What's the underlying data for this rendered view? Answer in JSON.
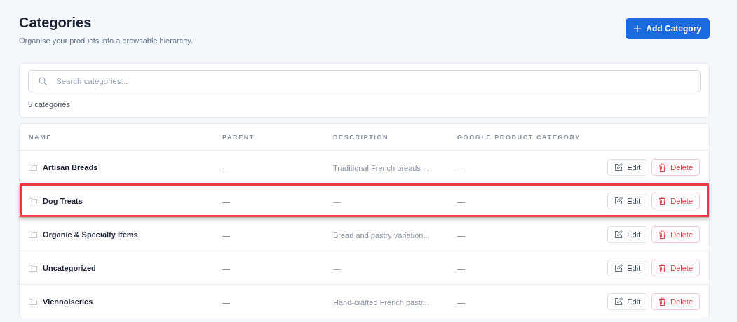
{
  "header": {
    "title": "Categories",
    "subtitle": "Organise your products into a browsable hierarchy.",
    "add_button": "Add Category"
  },
  "search": {
    "placeholder": "Search categories...",
    "count": "5 categories"
  },
  "table": {
    "columns": [
      "NAME",
      "PARENT",
      "DESCRIPTION",
      "GOOGLE PRODUCT CATEGORY"
    ],
    "rows": [
      {
        "name": "Artisan Breads",
        "parent": "—",
        "description": "Traditional French breads ...",
        "google_category": "—",
        "edit": "Edit",
        "delete": "Delete",
        "selected": false
      },
      {
        "name": "Dog Treats",
        "parent": "—",
        "description": "—",
        "google_category": "—",
        "edit": "Edit",
        "delete": "Delete",
        "selected": true
      },
      {
        "name": "Organic & Specialty Items",
        "parent": "—",
        "description": "Bread and pastry variation...",
        "google_category": "—",
        "edit": "Edit",
        "delete": "Delete",
        "selected": false
      },
      {
        "name": "Uncategorized",
        "parent": "—",
        "description": "—",
        "google_category": "—",
        "edit": "Edit",
        "delete": "Delete",
        "selected": false
      },
      {
        "name": "Viennoiseries",
        "parent": "—",
        "description": "Hand-crafted French pastr...",
        "google_category": "—",
        "edit": "Edit",
        "delete": "Delete",
        "selected": false
      }
    ]
  }
}
